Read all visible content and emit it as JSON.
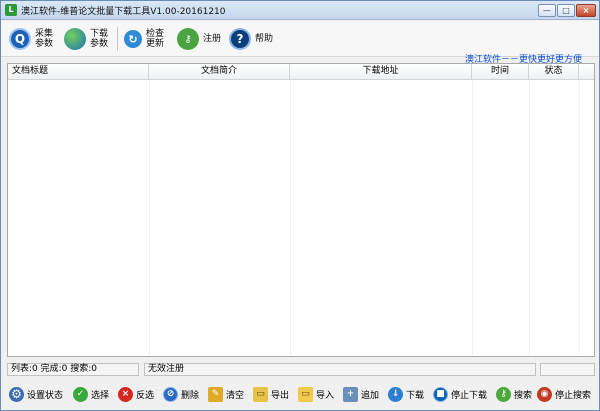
{
  "window": {
    "title": "澳江软件-维普论文批量下载工具V1.00-20161210",
    "app_icon_glyph": "L"
  },
  "toolbar": {
    "collect": "采集\n参数",
    "download_params": "下载\n参数",
    "check_update": "检查\n更新",
    "register": "注册",
    "help": "帮助",
    "link": "澳江软件－－更快更好更方便"
  },
  "table": {
    "headers": [
      "文档标题",
      "文档简介",
      "下载地址",
      "时间",
      "状态"
    ]
  },
  "status": {
    "counts": "列表:0 完成:0 搜索:0",
    "registration": "无效注册"
  },
  "bottom": {
    "settings": "设置状态",
    "select": "选择",
    "invert": "反选",
    "delete": "删除",
    "clear": "清空",
    "export": "导出",
    "import": "导入",
    "append": "追加",
    "download": "下载",
    "stop_download": "停止下载",
    "search": "搜索",
    "stop_search": "停止搜索"
  },
  "colors": {
    "accent": "#0b4fd8",
    "green": "#37a83b",
    "red": "#d7281f",
    "blue": "#2a6bc7"
  }
}
